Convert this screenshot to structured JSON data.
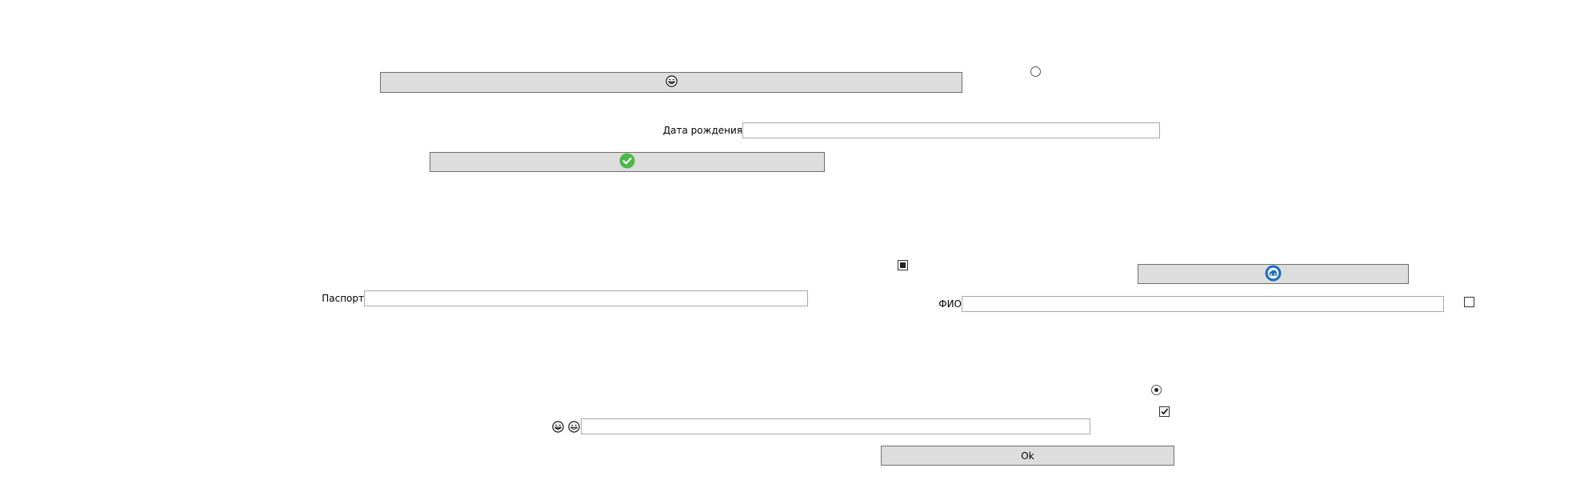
{
  "form": {
    "birth_date_label": "Дата рождения",
    "birth_date_value": "",
    "passport_label": "Паспорт",
    "passport_value": "",
    "fio_label": "ФИО",
    "fio_value": "",
    "bottom_field_value": "",
    "ok_label": "Ok"
  },
  "icons": {
    "top_button_icon": "laughing-face-icon",
    "check_button_icon": "green-check-icon",
    "blue_button_icon": "blue-badge-icon",
    "bottom_left_icon_1": "laughing-face-icon",
    "bottom_left_icon_2": "grinning-face-icon"
  },
  "colors": {
    "check_green": "#4cb848",
    "badge_blue": "#1a6fc0",
    "button_face": "#dddddd"
  },
  "controls": {
    "radio_top_checked": false,
    "radio_bottom_checked": true,
    "checkbox_mid_state": "indeterminate",
    "checkbox_right_checked": false,
    "checkbox_bottom_checked": true
  }
}
